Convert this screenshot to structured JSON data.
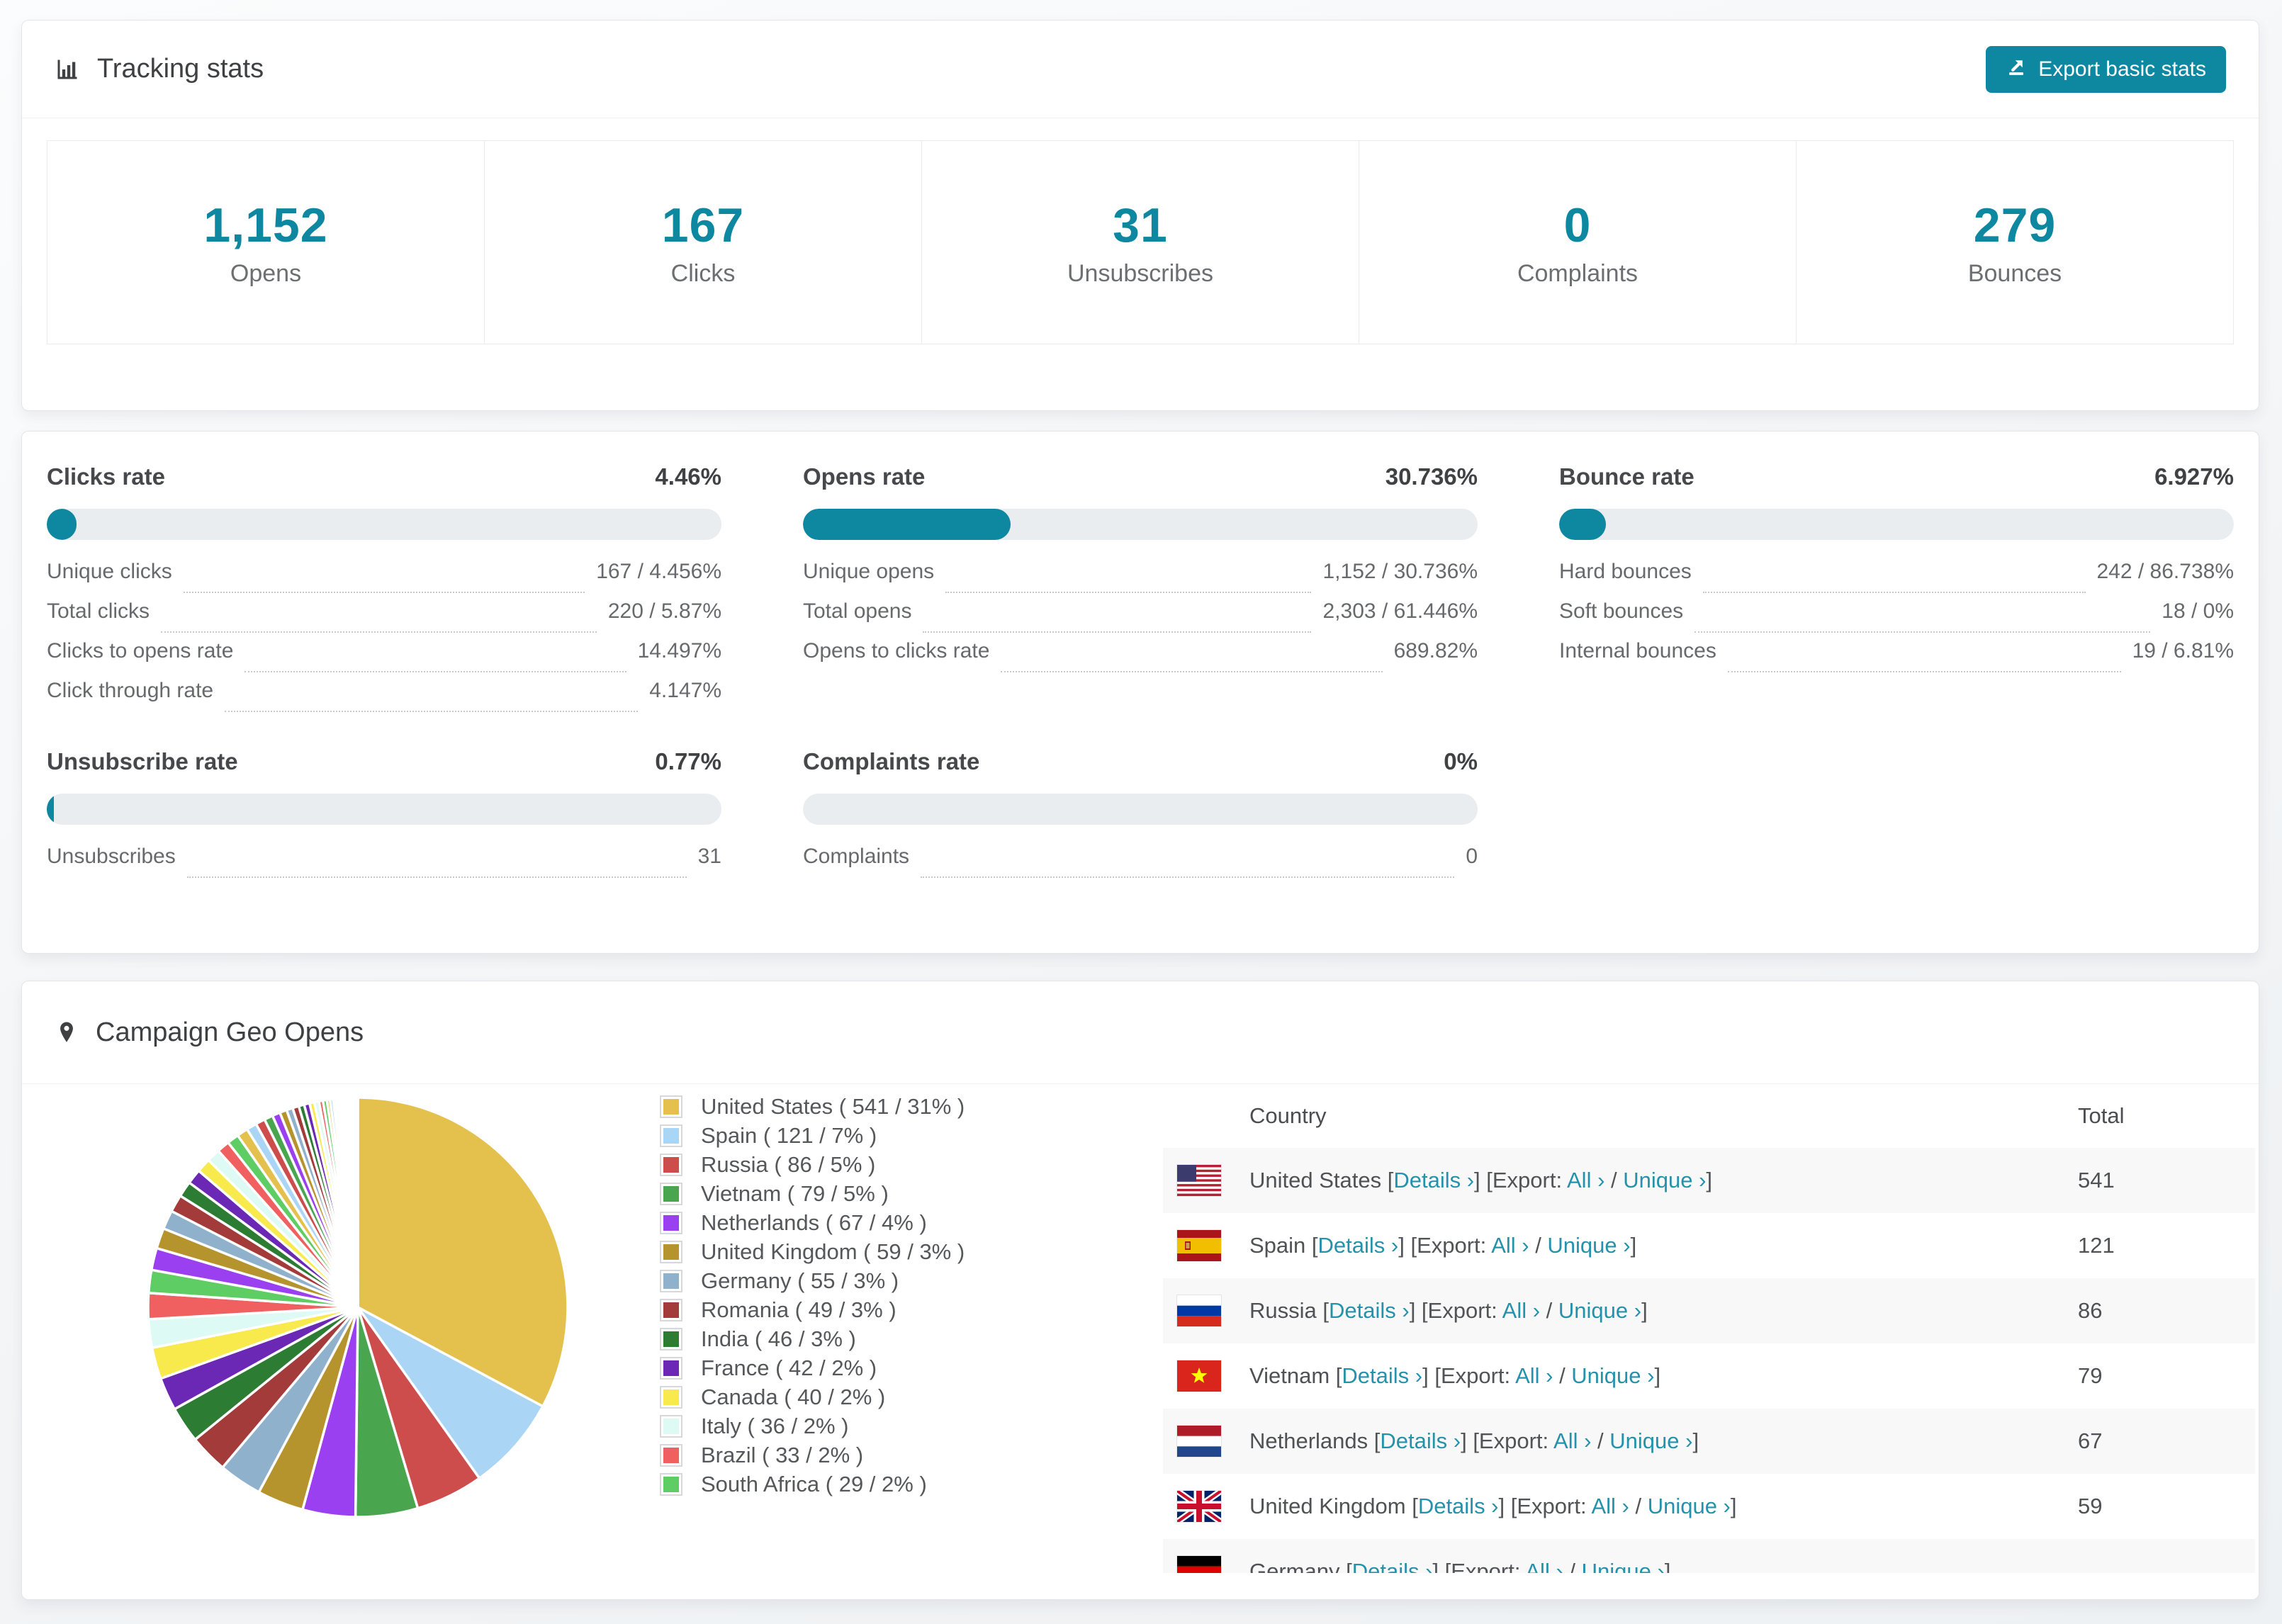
{
  "colors": {
    "accent_teal": "#0e87a0",
    "link_teal": "#2592ac",
    "bar_track": "#e9edf0",
    "row_alt_bg": "#f8f8f9"
  },
  "tracking": {
    "title": "Tracking stats",
    "export_label": "Export basic stats",
    "stats": [
      {
        "value": "1,152",
        "label": "Opens"
      },
      {
        "value": "167",
        "label": "Clicks"
      },
      {
        "value": "31",
        "label": "Unsubscribes"
      },
      {
        "value": "0",
        "label": "Complaints"
      },
      {
        "value": "279",
        "label": "Bounces"
      }
    ]
  },
  "rates": {
    "blocks": [
      {
        "title": "Clicks rate",
        "value": "4.46%",
        "fill_pct": 4.46,
        "rows": [
          {
            "label": "Unique clicks",
            "value": "167 / 4.456%"
          },
          {
            "label": "Total clicks",
            "value": "220 / 5.87%"
          },
          {
            "label": "Clicks to opens rate",
            "value": "14.497%"
          },
          {
            "label": "Click through rate",
            "value": "4.147%"
          }
        ]
      },
      {
        "title": "Opens rate",
        "value": "30.736%",
        "fill_pct": 30.736,
        "rows": [
          {
            "label": "Unique opens",
            "value": "1,152 / 30.736%"
          },
          {
            "label": "Total opens",
            "value": "2,303 / 61.446%"
          },
          {
            "label": "Opens to clicks rate",
            "value": "689.82%"
          }
        ]
      },
      {
        "title": "Bounce rate",
        "value": "6.927%",
        "fill_pct": 6.927,
        "rows": [
          {
            "label": "Hard bounces",
            "value": "242 / 86.738%"
          },
          {
            "label": "Soft bounces",
            "value": "18 / 0%"
          },
          {
            "label": "Internal bounces",
            "value": "19 / 6.81%"
          }
        ]
      },
      {
        "title": "Unsubscribe rate",
        "value": "0.77%",
        "fill_pct": 0.77,
        "rows": [
          {
            "label": "Unsubscribes",
            "value": "31"
          }
        ]
      },
      {
        "title": "Complaints rate",
        "value": "0%",
        "fill_pct": 0,
        "rows": [
          {
            "label": "Complaints",
            "value": "0"
          }
        ]
      }
    ]
  },
  "geo": {
    "title": "Campaign Geo Opens",
    "columns": [
      "Country",
      "Total"
    ],
    "link_labels": {
      "details": "Details ›",
      "export_prefix": "Export:",
      "all": "All ›",
      "unique": "Unique ›"
    },
    "rows": [
      {
        "flag": "us",
        "country": "United States",
        "total": "541"
      },
      {
        "flag": "es",
        "country": "Spain",
        "total": "121"
      },
      {
        "flag": "ru",
        "country": "Russia",
        "total": "86"
      },
      {
        "flag": "vn",
        "country": "Vietnam",
        "total": "79"
      },
      {
        "flag": "nl",
        "country": "Netherlands",
        "total": "67"
      },
      {
        "flag": "gb",
        "country": "United Kingdom",
        "total": "59"
      },
      {
        "flag": "de",
        "country": "Germany",
        "total": ""
      }
    ]
  },
  "chart_data": {
    "type": "pie",
    "title": "Campaign Geo Opens",
    "legend_position": "right-of-pie",
    "start_angle_deg": -90,
    "direction": "clockwise",
    "series": [
      {
        "label": "United States",
        "value": 541,
        "pct_label": "31%",
        "color": "#e4c04c"
      },
      {
        "label": "Spain",
        "value": 121,
        "pct_label": "7%",
        "color": "#abd5f5"
      },
      {
        "label": "Russia",
        "value": 86,
        "pct_label": "5%",
        "color": "#cd4c4c"
      },
      {
        "label": "Vietnam",
        "value": 79,
        "pct_label": "5%",
        "color": "#4aa64e"
      },
      {
        "label": "Netherlands",
        "value": 67,
        "pct_label": "4%",
        "color": "#9b40f0"
      },
      {
        "label": "United Kingdom",
        "value": 59,
        "pct_label": "3%",
        "color": "#b6942d"
      },
      {
        "label": "Germany",
        "value": 55,
        "pct_label": "3%",
        "color": "#8fb1cc"
      },
      {
        "label": "Romania",
        "value": 49,
        "pct_label": "3%",
        "color": "#a33b3b"
      },
      {
        "label": "India",
        "value": 46,
        "pct_label": "3%",
        "color": "#2c7d33"
      },
      {
        "label": "France",
        "value": 42,
        "pct_label": "2%",
        "color": "#6b28b4"
      },
      {
        "label": "Canada",
        "value": 40,
        "pct_label": "2%",
        "color": "#f8e94d"
      },
      {
        "label": "Italy",
        "value": 36,
        "pct_label": "2%",
        "color": "#defaf4"
      },
      {
        "label": "Brazil",
        "value": 33,
        "pct_label": "2%",
        "color": "#f06060"
      },
      {
        "label": "South Africa",
        "value": 29,
        "pct_label": "2%",
        "color": "#5ecd63"
      }
    ],
    "legend_label_format": "{label} ( {value} / {pct} )",
    "others_estimated_tail": [
      28,
      26,
      24,
      22,
      20,
      19,
      18,
      17,
      16,
      15,
      14,
      13,
      12,
      11,
      10,
      9,
      8,
      8,
      7,
      7,
      6,
      6,
      5,
      5,
      4,
      4,
      3,
      3,
      3,
      2,
      2,
      2,
      2,
      2,
      1,
      1,
      1,
      1,
      1,
      1,
      1,
      1,
      1,
      1,
      1,
      1
    ]
  }
}
